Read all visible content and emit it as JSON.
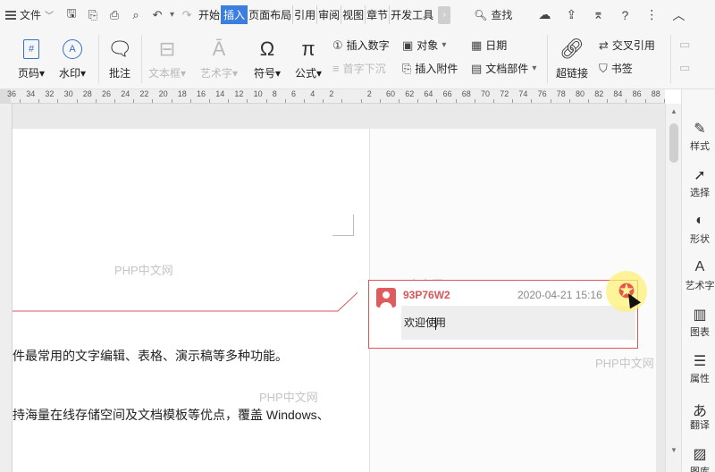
{
  "menubar": {
    "file_label": "文件",
    "tabs": [
      "开始",
      "插入",
      "页面布局",
      "引用",
      "审阅",
      "视图",
      "章节",
      "开发工具"
    ],
    "active_tab": "插入",
    "search_label": "查找"
  },
  "ribbon": {
    "page_number": "页码",
    "watermark": "水印",
    "comment": "批注",
    "textbox": "文本框",
    "wordart": "艺术字",
    "symbol": "符号",
    "formula": "公式",
    "insert_number": "插入数字",
    "drop_cap": "首字下沉",
    "object": "对象",
    "insert_attachment": "插入附件",
    "date": "日期",
    "doc_parts": "文档部件",
    "hyperlink": "超链接",
    "cross_reference": "交叉引用",
    "bookmark": "书签"
  },
  "ruler": {
    "labels": [
      "36",
      "34",
      "32",
      "30",
      "28",
      "26",
      "24",
      "22",
      "20",
      "18",
      "16",
      "14",
      "12",
      "10",
      "8",
      "6",
      "4",
      "2",
      "",
      "2",
      "60",
      "62",
      "64",
      "66",
      "68",
      "70",
      "72",
      "74",
      "76",
      "78",
      "80",
      "82",
      "84",
      "86",
      "88"
    ]
  },
  "document": {
    "line1": "件最常用的文字编辑、表格、演示稿等多种功能。",
    "line2": "持海量在线存储空间及文档模板等优点，覆盖 Windows、",
    "watermark_text": "PHP中文网"
  },
  "comment": {
    "user": "93P76W2",
    "time": "2020-04-21 15:16",
    "text_before_caret": "欢迎使",
    "text_after_caret": "用"
  },
  "sidepanel": {
    "items": [
      "样式",
      "选择",
      "形状",
      "艺术字",
      "图表",
      "属性",
      "翻译",
      "图库"
    ]
  },
  "colors": {
    "accent": "#3c7de0",
    "comment_red": "#d9565a"
  }
}
